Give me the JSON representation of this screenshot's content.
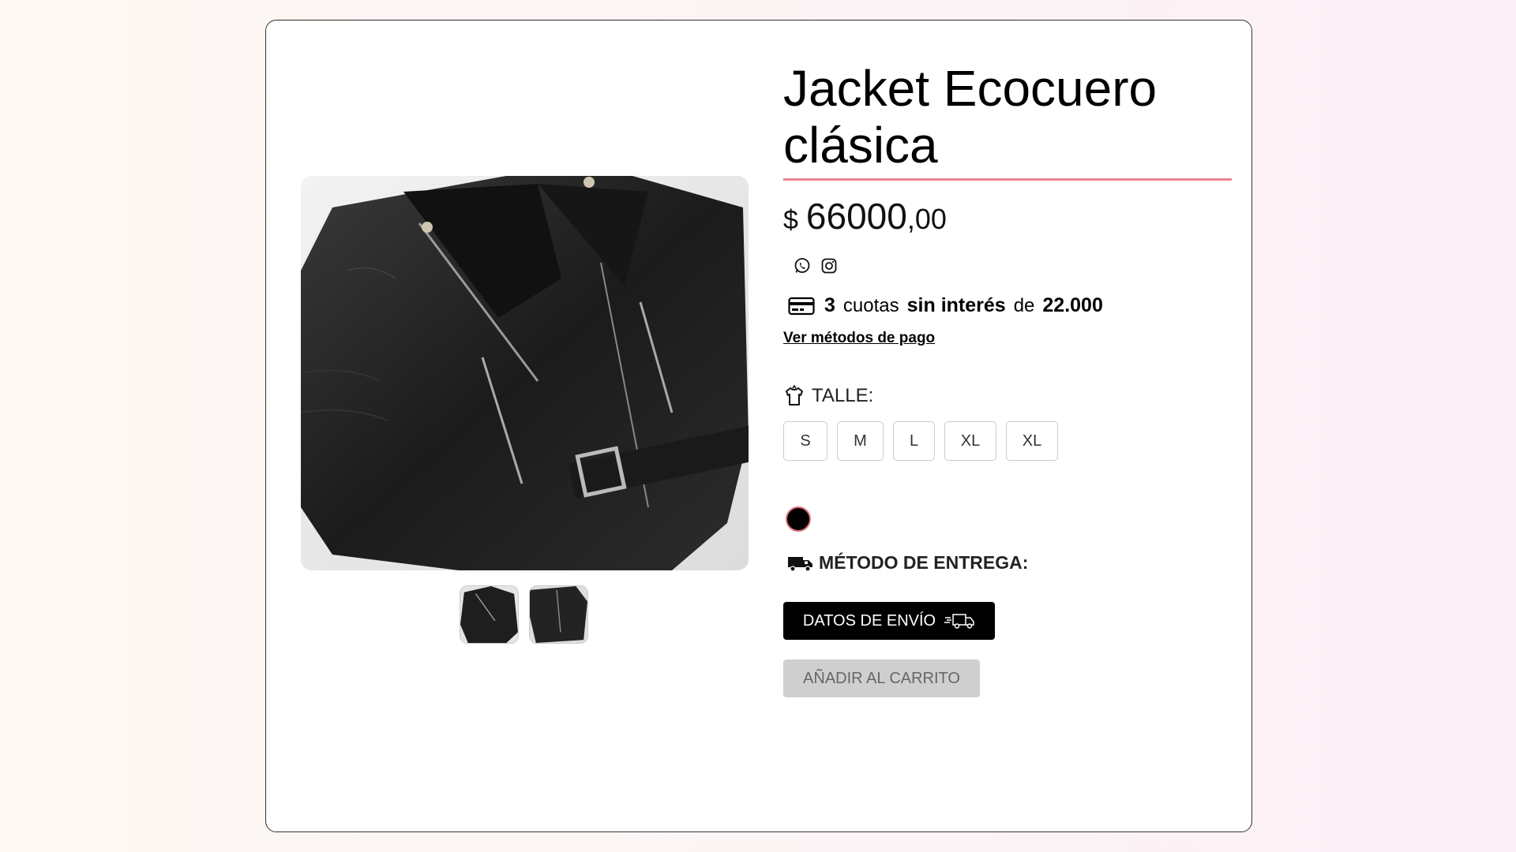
{
  "product": {
    "title_line1": "Jacket Ecocuero",
    "title_line2": "clásica",
    "price_currency": "$",
    "price_integer": "66000",
    "price_decimals": ",00",
    "image_alt": "Jacket Ecocuero clásica"
  },
  "social": {
    "whatsapp_icon": "whatsapp-icon",
    "instagram_icon": "instagram-icon"
  },
  "installments": {
    "count": "3",
    "word_cuotas": "cuotas",
    "interest_text": "sin interés",
    "word_de": "de",
    "amount": "22.000",
    "payment_methods_link": "Ver métodos de pago"
  },
  "size": {
    "label": "TALLE:",
    "options": [
      "S",
      "M",
      "L",
      "XL",
      "XL"
    ]
  },
  "color": {
    "selected": "#000000",
    "ring": "#e5707f"
  },
  "delivery": {
    "label": "MÉTODO DE ENTREGA:",
    "shipping_button": "DATOS DE ENVÍO",
    "add_to_cart_button": "AÑADIR AL CARRITO"
  },
  "theme": {
    "accent": "#e98590",
    "primary_button": "#000000",
    "disabled_button": "#cfcfcf"
  }
}
